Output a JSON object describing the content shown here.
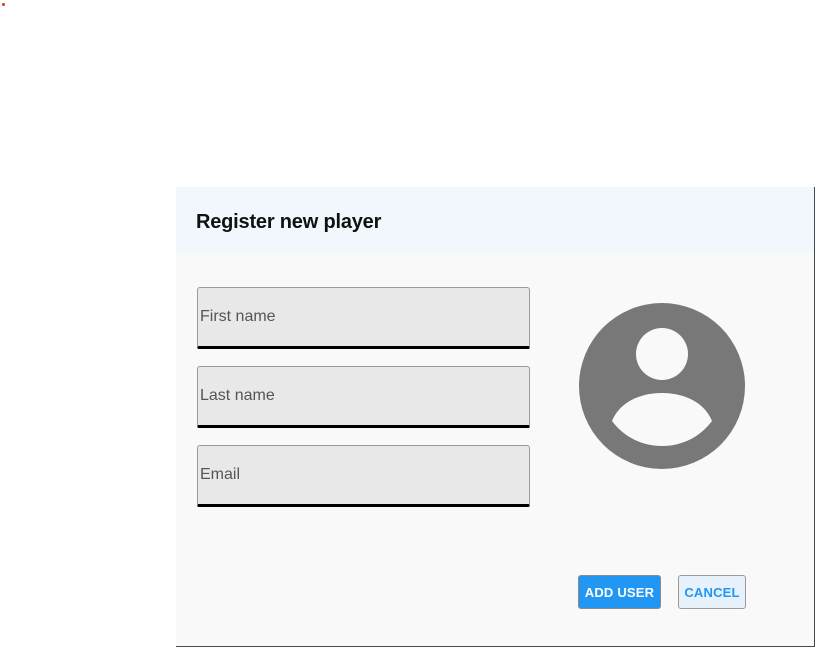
{
  "dialog": {
    "title": "Register new player",
    "fields": {
      "first_name": {
        "placeholder": "First name",
        "value": ""
      },
      "last_name": {
        "placeholder": "Last name",
        "value": ""
      },
      "email": {
        "placeholder": "Email",
        "value": ""
      }
    },
    "avatar_icon": "account-circle-icon",
    "buttons": {
      "add_user": "ADD USER",
      "cancel": "CANCEL"
    }
  },
  "colors": {
    "header_bg": "#f1f7fd",
    "dialog_bg": "#f9f9f9",
    "field_bg": "#e8e8e8",
    "avatar": "#787878",
    "primary": "#2196f3",
    "cancel_bg": "#e6f1fb"
  }
}
